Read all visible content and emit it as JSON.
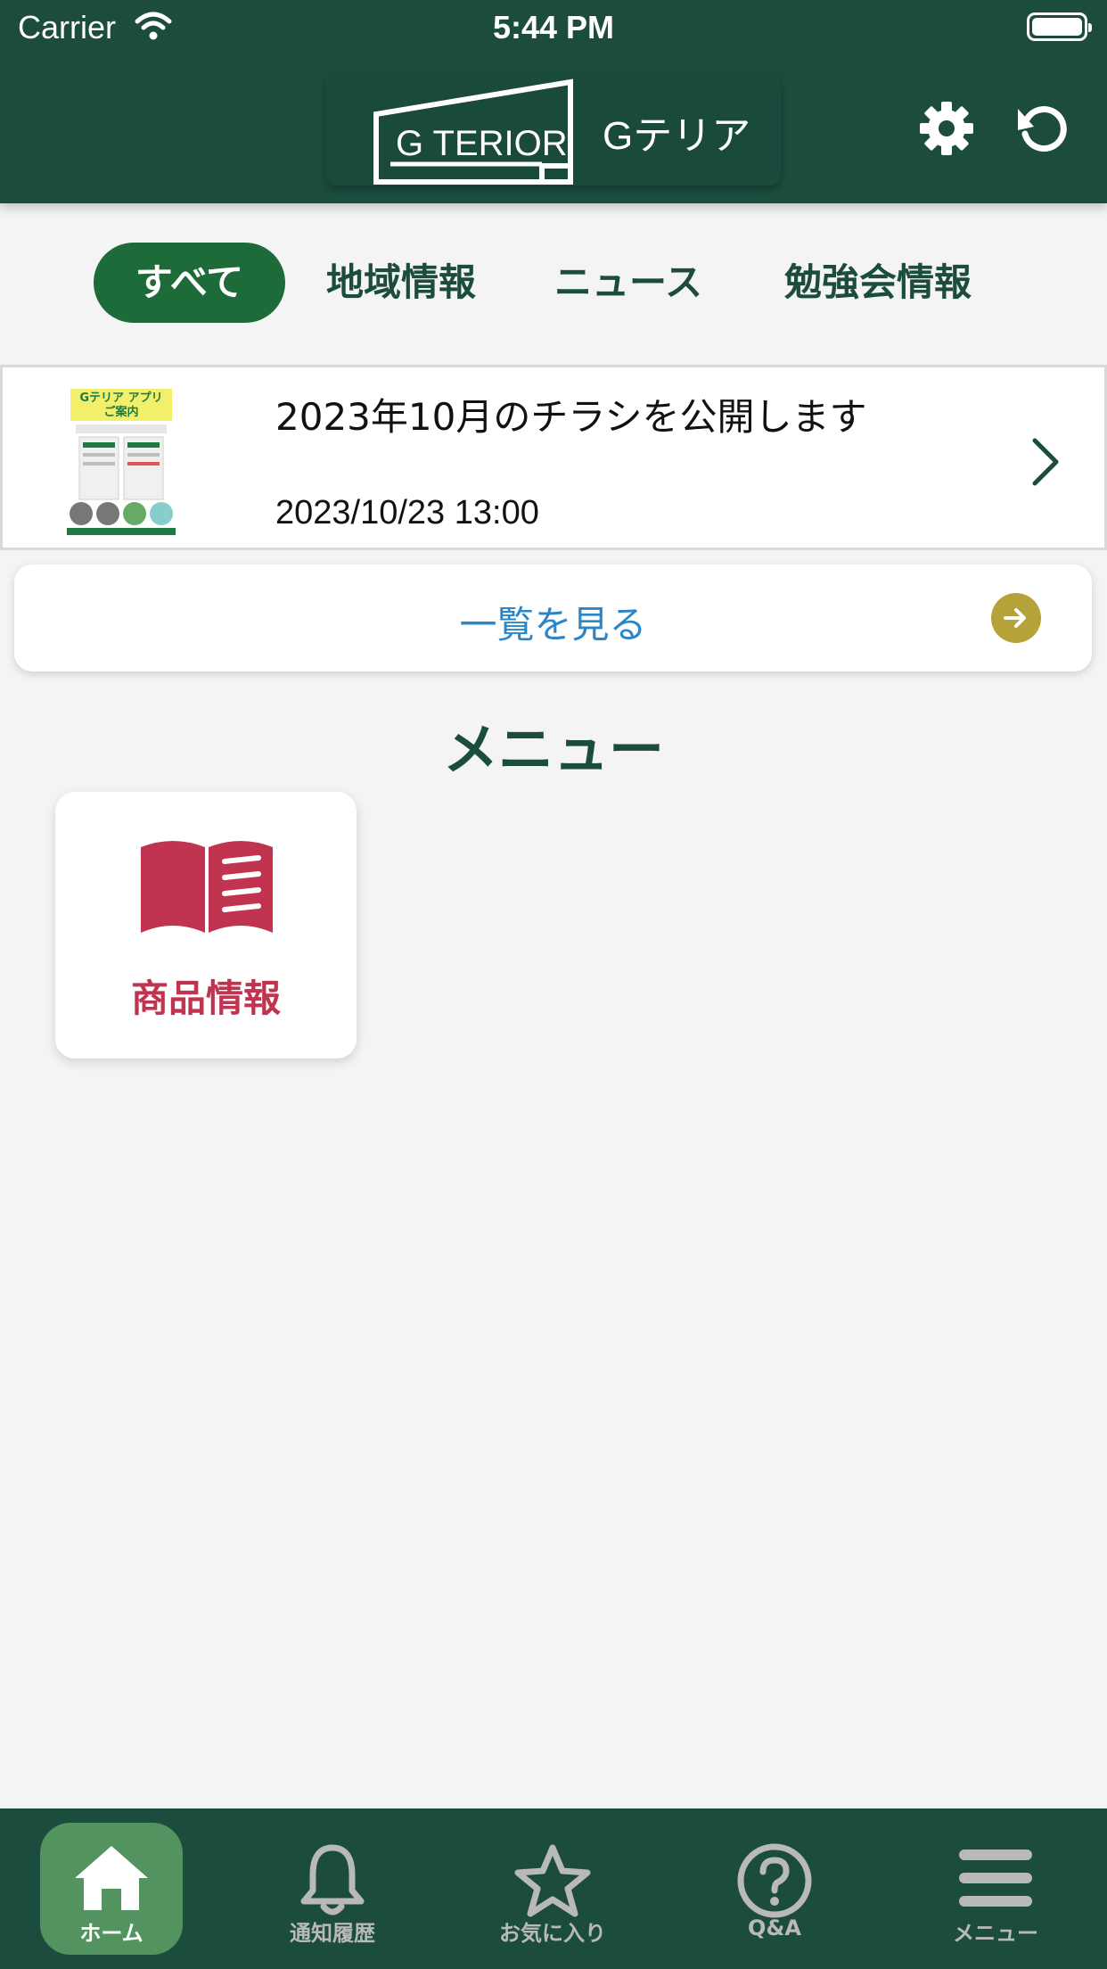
{
  "status_bar": {
    "carrier": "Carrier",
    "time": "5:44 PM"
  },
  "header": {
    "app_name": "Gテリア",
    "logo_text": "G TERIOR"
  },
  "tabs": [
    {
      "label": "すべて",
      "active": true
    },
    {
      "label": "地域情報",
      "active": false
    },
    {
      "label": "ニュース",
      "active": false
    },
    {
      "label": "勉強会情報",
      "active": false
    }
  ],
  "news": {
    "title": "2023年10月のチラシを公開します",
    "date": "2023/10/23 13:00",
    "thumb": {
      "line1": "Gテリア アプリ",
      "line2": "ご案内"
    }
  },
  "list_button": {
    "label": "一覧を見る"
  },
  "menu": {
    "heading": "メニュー",
    "items": [
      {
        "label": "商品情報",
        "icon": "book-icon"
      }
    ]
  },
  "tabbar": [
    {
      "label": "ホーム",
      "icon": "home-icon",
      "active": true
    },
    {
      "label": "通知履歴",
      "icon": "bell-icon",
      "active": false
    },
    {
      "label": "お気に入り",
      "icon": "star-icon",
      "active": false
    },
    {
      "label": "Q&A",
      "icon": "question-icon",
      "active": false
    },
    {
      "label": "メニュー",
      "icon": "hamburger-icon",
      "active": false
    }
  ],
  "colors": {
    "header_bg": "#1b4c3e",
    "tab_active": "#1e6b3a",
    "accent_red": "#c0344f",
    "link_blue": "#2b86c7",
    "arrow_gold": "#b5a238"
  }
}
